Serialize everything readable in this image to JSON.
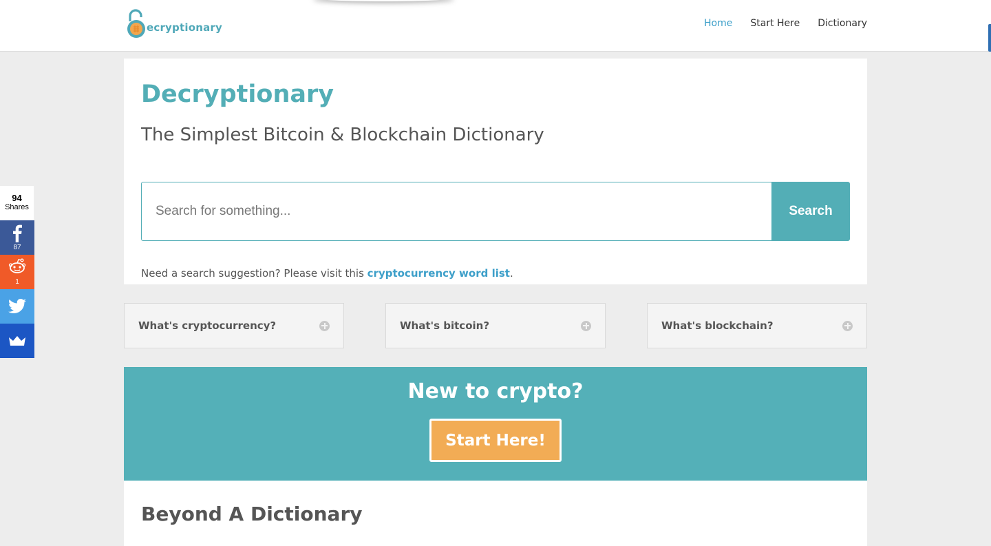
{
  "header": {
    "logo_text": "ecryptionary",
    "nav": [
      {
        "label": "Home",
        "active": true
      },
      {
        "label": "Start Here",
        "active": false
      },
      {
        "label": "Dictionary",
        "active": false
      }
    ]
  },
  "hero": {
    "title": "Decryptionary",
    "subtitle": "The Simplest Bitcoin & Blockchain Dictionary",
    "search_placeholder": "Search for something...",
    "search_button": "Search",
    "suggestion_text": "Need a search suggestion? Please visit this ",
    "suggestion_link": "cryptocurrency word list",
    "suggestion_end": "."
  },
  "toggles": [
    {
      "label": "What's cryptocurrency?"
    },
    {
      "label": "What's bitcoin?"
    },
    {
      "label": "What's blockchain?"
    }
  ],
  "cta": {
    "title": "New to crypto?",
    "button": "Start Here!"
  },
  "beyond": {
    "title": "Beyond A Dictionary"
  },
  "share": {
    "total": "94",
    "total_label": "Shares",
    "facebook_count": "87",
    "reddit_count": "1"
  },
  "colors": {
    "accent": "#53aeb6",
    "link": "#3d9fc9",
    "cta_button": "#f2ac55"
  }
}
